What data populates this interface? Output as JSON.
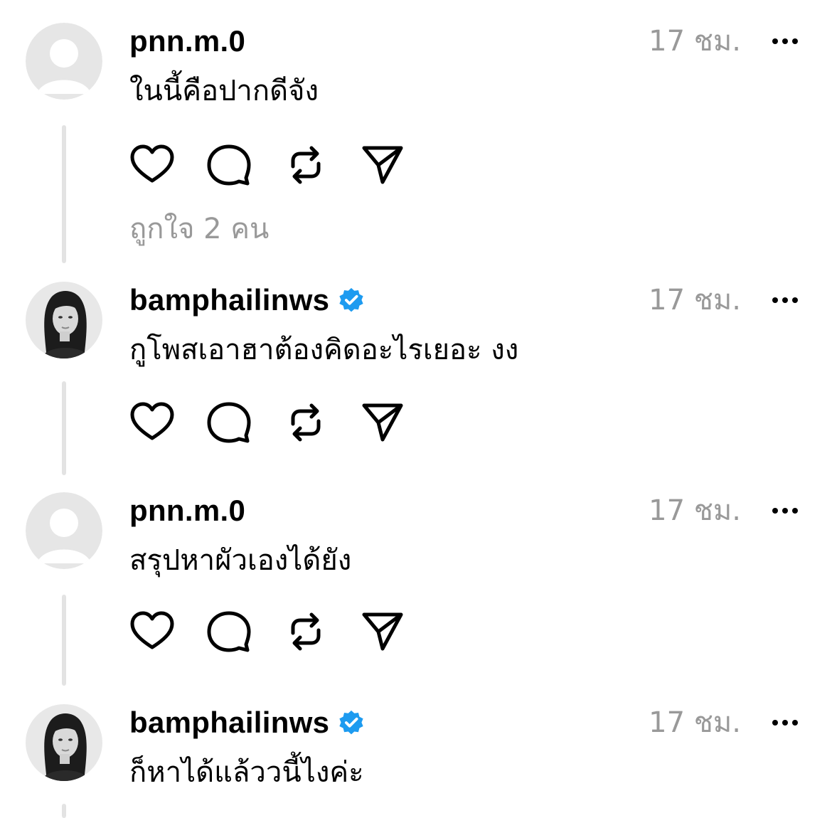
{
  "comments": [
    {
      "username": "pnn.m.0",
      "verified": false,
      "avatar": "default-avatar",
      "time": "17 ชม.",
      "text": "ในนี้คือปากดีจัง",
      "likes": "ถูกใจ 2 คน"
    },
    {
      "username": "bamphailinws",
      "verified": true,
      "avatar": "profile-photo",
      "time": "17 ชม.",
      "text": "กูโพสเอาฮาต้องคิดอะไรเยอะ งง"
    },
    {
      "username": "pnn.m.0",
      "verified": false,
      "avatar": "default-avatar",
      "time": "17 ชม.",
      "text": "สรุปหาผัวเองได้ยัง"
    },
    {
      "username": "bamphailinws",
      "verified": true,
      "avatar": "profile-photo",
      "time": "17 ชม.",
      "text": "ก็หาได้แล้ววนี้ไงค่ะ"
    }
  ],
  "icons": {
    "like": "heart-icon",
    "reply": "comment-icon",
    "repost": "repost-icon",
    "share": "send-icon",
    "more": "more-options-icon",
    "verified": "verified-badge-icon"
  },
  "colors": {
    "verified": "#1d9bf0",
    "secondary_text": "#999999",
    "thread_line": "#e3e3e3",
    "default_avatar_bg": "#e6e6e6"
  }
}
